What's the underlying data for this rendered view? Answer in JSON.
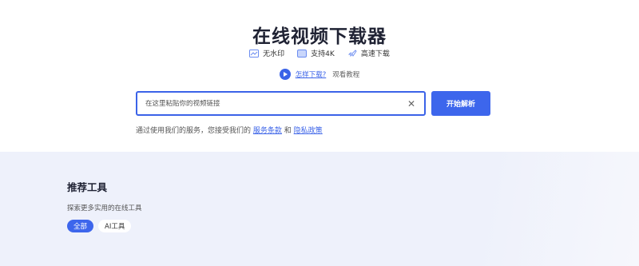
{
  "hero": {
    "title": "在线视频下载器",
    "features": [
      {
        "icon": "no-watermark-icon",
        "label": "无水印"
      },
      {
        "icon": "4k-icon",
        "label": "支持4K"
      },
      {
        "icon": "rocket-icon",
        "label": "高速下载"
      }
    ],
    "howto": {
      "link": "怎样下载?",
      "text": "观看教程"
    }
  },
  "search": {
    "placeholder": "在这里粘贴你的视频链接",
    "value": "",
    "clear_icon": "close-icon",
    "button_label": "开始解析"
  },
  "terms": {
    "prefix": "通过使用我们的服务，您接受我们的",
    "link1": "服务条款",
    "joiner": "和",
    "link2": "隐私政策"
  },
  "tools": {
    "title": "推荐工具",
    "subtitle": "探索更多实用的在线工具",
    "chips": [
      {
        "label": "全部",
        "active": true
      },
      {
        "label": "AI工具",
        "active": false
      }
    ]
  },
  "colors": {
    "accent": "#3d66ec",
    "lower_bg": "#eef1fb"
  }
}
